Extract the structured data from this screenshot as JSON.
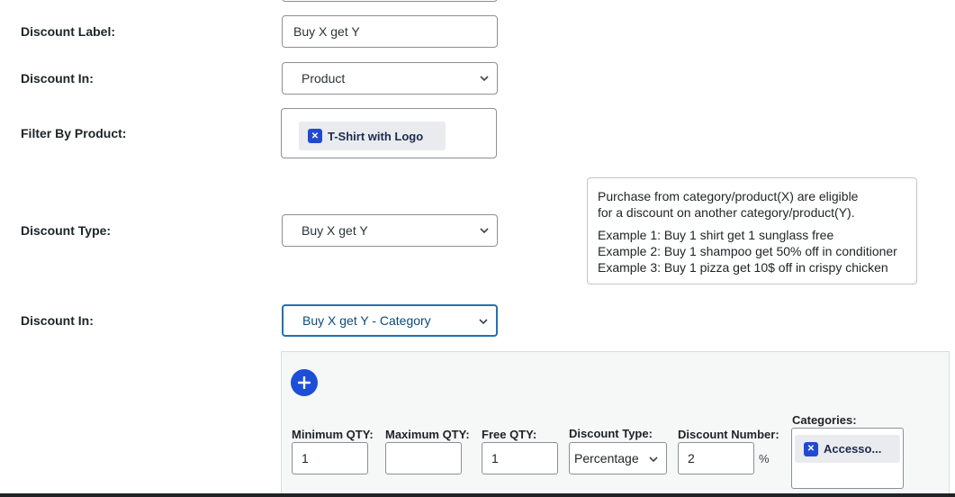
{
  "form": {
    "discount_label": {
      "label": "Discount Label:",
      "value": "Buy X get Y"
    },
    "discount_in": {
      "label": "Discount In:",
      "value": "Product"
    },
    "filter_by_product": {
      "label": "Filter By Product:",
      "chips": [
        "T-Shirt with Logo"
      ]
    },
    "discount_type": {
      "label": "Discount Type:",
      "value": "Buy X get Y"
    },
    "discount_in_2": {
      "label": "Discount In:",
      "value": "Buy X get Y - Category"
    }
  },
  "info_box": {
    "line1": "Purchase from category/product(X) are eligible",
    "line2": "for a discount on another category/product(Y).",
    "example1": "Example 1: Buy 1 shirt get 1 sunglass free",
    "example2": "Example 2: Buy 1 shampoo get 50% off in conditioner",
    "example3": "Example 3: Buy 1 pizza get 10$ off in crispy chicken"
  },
  "rules": {
    "add_icon": "plus-icon",
    "min_qty": {
      "label": "Minimum QTY:",
      "value": "1"
    },
    "max_qty": {
      "label": "Maximum QTY:",
      "value": ""
    },
    "free_qty": {
      "label": "Free QTY:",
      "value": "1"
    },
    "discount_type": {
      "label": "Discount Type:",
      "value": "Percentage"
    },
    "discount_number": {
      "label": "Discount Number:",
      "value": "2",
      "suffix": "%"
    },
    "categories": {
      "label": "Categories:",
      "chips": [
        "Accesso..."
      ]
    }
  },
  "colors": {
    "accent": "#2271b1",
    "chip_remove": "#2149d0",
    "add_button": "#1d4ed8"
  }
}
